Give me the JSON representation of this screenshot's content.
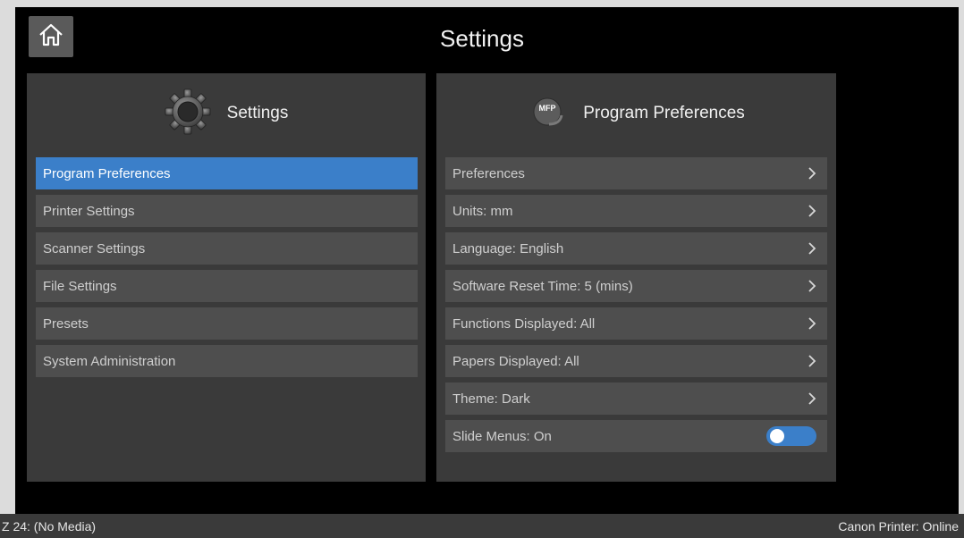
{
  "header": {
    "title": "Settings",
    "home_icon": "home-icon"
  },
  "settings_panel": {
    "title": "Settings",
    "icon": "gear-icon",
    "items": [
      {
        "label": "Program Preferences",
        "selected": true
      },
      {
        "label": "Printer Settings",
        "selected": false
      },
      {
        "label": "Scanner Settings",
        "selected": false
      },
      {
        "label": "File Settings",
        "selected": false
      },
      {
        "label": "Presets",
        "selected": false
      },
      {
        "label": "System Administration",
        "selected": false
      }
    ]
  },
  "preferences_panel": {
    "title": "Program Preferences",
    "icon": "mfp-icon",
    "icon_text": "MFP",
    "items": [
      {
        "label": "Preferences",
        "control": "chevron"
      },
      {
        "label": "Units: mm",
        "control": "chevron"
      },
      {
        "label": "Language: English",
        "control": "chevron"
      },
      {
        "label": "Software Reset Time: 5 (mins)",
        "control": "chevron"
      },
      {
        "label": "Functions Displayed: All",
        "control": "chevron"
      },
      {
        "label": "Papers Displayed: All",
        "control": "chevron"
      },
      {
        "label": "Theme: Dark",
        "control": "chevron"
      },
      {
        "label": "Slide Menus: On",
        "control": "toggle",
        "toggle_on": true
      }
    ]
  },
  "status_bar": {
    "left": "Z 24: (No Media)",
    "right": "Canon Printer: Online"
  },
  "colors": {
    "accent": "#3b7fc9",
    "panel": "#3a3a3a",
    "item": "#4e4e4e",
    "background": "#000000"
  }
}
